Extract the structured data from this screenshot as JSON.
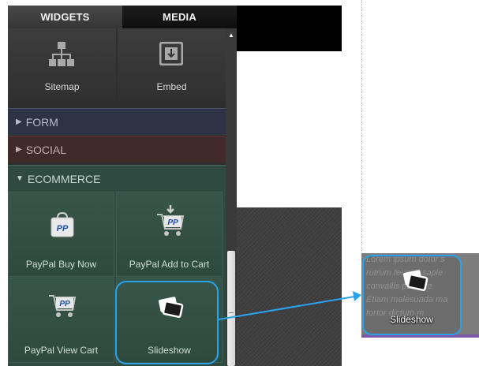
{
  "tabs": {
    "widgets": "WIDGETS",
    "media": "MEDIA"
  },
  "tiles": {
    "sitemap": "Sitemap",
    "embed": "Embed"
  },
  "categories": {
    "form": "FORM",
    "social": "SOCIAL",
    "ecommerce": "ECOMMERCE"
  },
  "ecommerce_items": {
    "buy_now": "PayPal Buy Now",
    "add_to_cart": "PayPal Add to Cart",
    "view_cart": "PayPal View Cart",
    "slideshow": "Slideshow"
  },
  "paypal_badge": "PP",
  "drop_preview": {
    "label": "Slideshow",
    "lorem_lines": [
      "Lorem ipsum dolor s",
      "rutrum feugiat saple",
      "convallis pellente",
      "Etiam malesuada ma",
      "tortor dictum m"
    ]
  },
  "colors": {
    "accent": "#2aa3ef",
    "panel": "#2e2e2e",
    "ecommerce": "#2f4a40"
  }
}
